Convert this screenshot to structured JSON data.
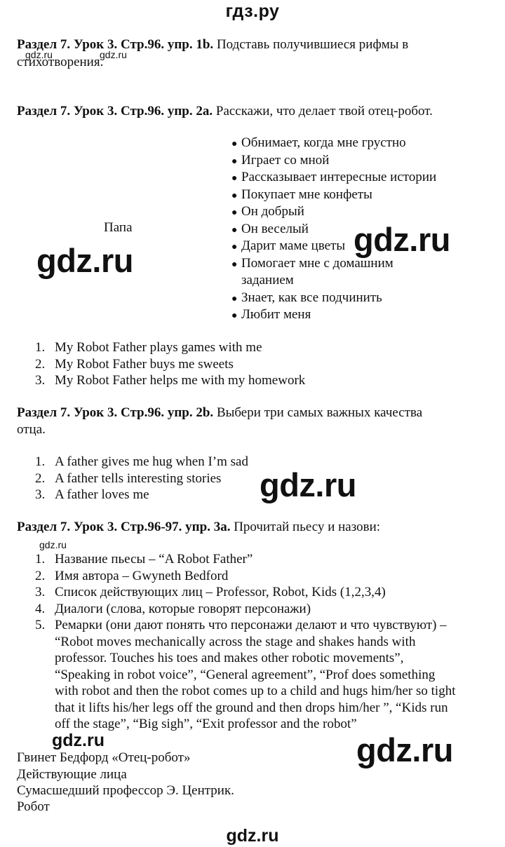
{
  "site_header": "гдз.ру",
  "watermarks": {
    "text": "gdz.ru"
  },
  "section_1b": {
    "heading": "Раздел 7. Урок 3. Стр.96. упр. 1b.",
    "task": " Подставь получившиеся рифмы в",
    "task_cont": "стихотворения."
  },
  "section_2a": {
    "heading": "Раздел 7. Урок 3. Стр.96. упр. 2a.",
    "task": " Расскажи, что делает твой отец-робот.",
    "center_word": "Папа",
    "bullets": [
      "Обнимает, когда мне грустно",
      "Играет со мной",
      "Рассказывает интересные истории",
      "Покупает мне конфеты",
      "Он добрый",
      "Он веселый",
      "Дарит маме цветы",
      "Помогает мне с домашним",
      "заданием",
      "Знает, как все подчинить",
      "Любит меня"
    ],
    "answers": [
      {
        "num": "1.",
        "text": "My Robot Father plays games with me"
      },
      {
        "num": "2.",
        "text": "My Robot Father buys me sweets"
      },
      {
        "num": "3.",
        "text": "My Robot Father helps me with my homework"
      }
    ]
  },
  "section_2b": {
    "heading": "Раздел 7. Урок 3. Стр.96. упр. 2b.",
    "task": " Выбери три самых важных качества",
    "task_cont": "отца.",
    "answers": [
      {
        "num": "1.",
        "text": "A father gives me hug when I’m sad"
      },
      {
        "num": "2.",
        "text": "A father tells interesting stories"
      },
      {
        "num": "3.",
        "text": "A father loves me"
      }
    ]
  },
  "section_3a": {
    "heading": "Раздел 7. Урок 3. Стр.96-97. упр. 3a.",
    "task": " Прочитай пьесу и назови:",
    "answers": [
      {
        "num": "1.",
        "text": "Название пьесы – “A Robot Father”"
      },
      {
        "num": "2.",
        "text": "Имя автора – Gwyneth Bedford"
      },
      {
        "num": "3.",
        "text": "Список действующих лиц – Professor, Robot, Kids (1,2,3,4)"
      },
      {
        "num": "4.",
        "text": "Диалоги (слова, которые говорят персонажи)"
      },
      {
        "num": "5.",
        "text": "Ремарки (они дают понять что персонажи делают и что чувствуют) –"
      }
    ],
    "item5_cont": [
      "“Robot moves mechanically across the stage and shakes hands with",
      "professor. Touches his toes and makes other robotic movements”,",
      "“Speaking in robot voice”, “General agreement”, “Prof does something",
      "with robot and then the robot comes up to a child and hugs him/her so tight",
      "that it lifts his/her legs off the ground and then drops him/her ”, “Kids run",
      "off the stage”, “Big sigh”, “Exit professor and the robot”"
    ]
  },
  "play_text": {
    "lines": [
      "Гвинет Бедфорд «Отец-робот»",
      "Действующие лица",
      "Сумасшедший профессор Э. Центрик.",
      "Робот"
    ]
  }
}
